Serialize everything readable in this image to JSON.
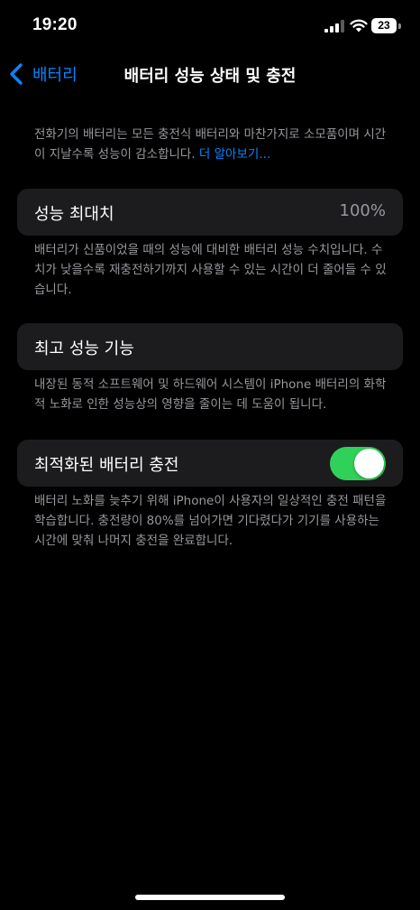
{
  "status_bar": {
    "time": "19:20",
    "battery_level": "23",
    "icons": [
      "signal-icon",
      "wifi-icon",
      "battery-icon"
    ]
  },
  "nav": {
    "back_label": "배터리",
    "title": "배터리 성능 상태 및 충전",
    "back_icon": "chevron-left-icon"
  },
  "intro": {
    "text": "전화기의 배터리는 모든 충전식 배터리와 마찬가지로 소모품이며 시간이 지날수록 성능이 감소합니다. ",
    "link": "더 알아보기..."
  },
  "max_capacity": {
    "label": "성능 최대치",
    "value": "100%",
    "footnote": "배터리가 신품이었을 때의 성능에 대비한 배터리 성능 수치입니다. 수치가 낮을수록 재충전하기까지 사용할 수 있는 시간이 더 줄어들 수 있습니다."
  },
  "peak_performance": {
    "label": "최고 성능 기능",
    "footnote": "내장된 동적 소프트웨어 및 하드웨어 시스템이 iPhone 배터리의 화학적 노화로 인한 성능상의 영향을 줄이는 데 도움이 됩니다."
  },
  "optimized_charging": {
    "label": "최적화된 배터리 충전",
    "enabled": true,
    "footnote": "배터리 노화를 늦추기 위해 iPhone이 사용자의 일상적인 충전 패턴을 학습합니다. 충전량이 80%를 넘어가면 기다렸다가 기기를 사용하는 시간에 맞춰 나머지 충전을 완료합니다."
  },
  "colors": {
    "background": "#000000",
    "cell_background": "#1c1c1e",
    "accent": "#0a84ff",
    "toggle_on": "#30d158",
    "secondary_text": "#98989e"
  }
}
